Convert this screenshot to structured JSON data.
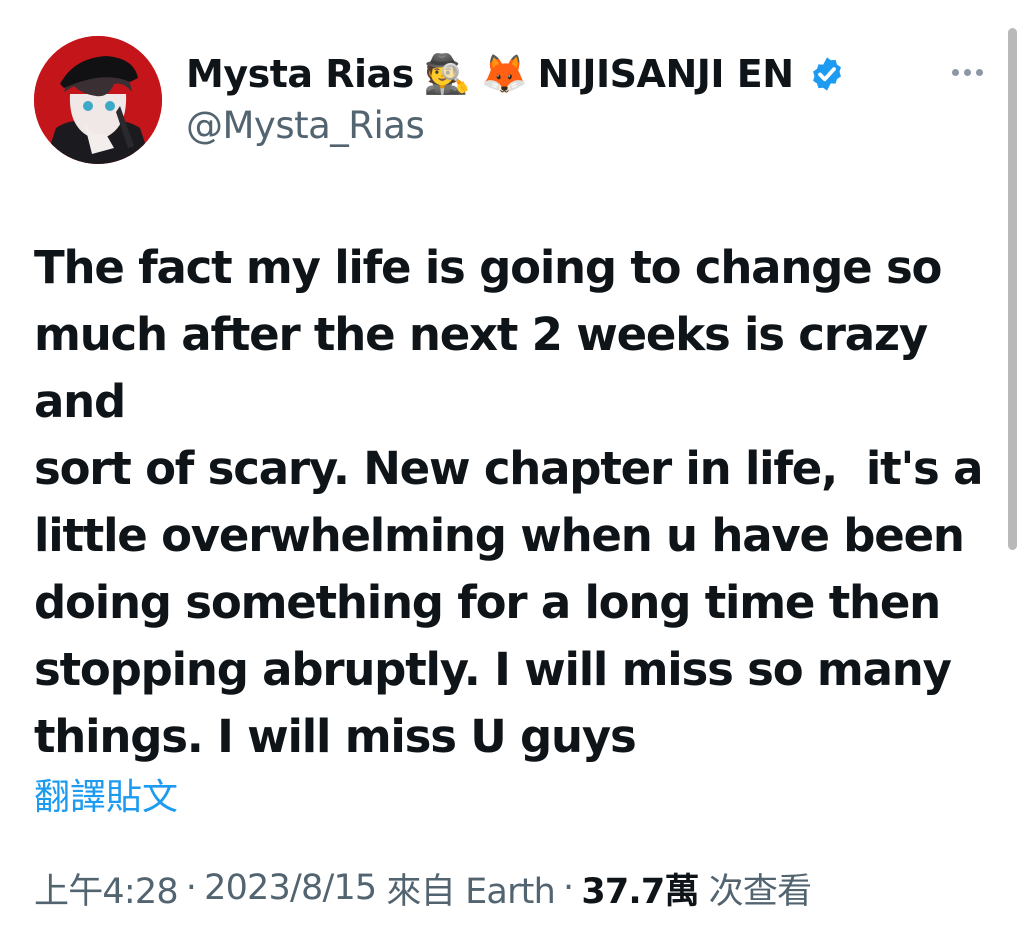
{
  "tweet": {
    "author": {
      "display_name": "Mysta Rias",
      "emoji_1": "🕵",
      "emoji_2": "🦊",
      "affiliation": "NIJISANJI EN",
      "handle": "@Mysta_Rias",
      "verified_icon": "verified-badge-icon",
      "avatar_icon": "avatar-image"
    },
    "body": "The fact my life is going to change so\nmuch after the next 2 weeks is crazy and\nsort of scary. New chapter in life,  it's a\nlittle overwhelming when u have been\ndoing something for a long time then\nstopping abruptly. I will miss so many\nthings. I will miss U guys",
    "translate_label": "翻譯貼文",
    "meta": {
      "time": "上午4:28",
      "date": "2023/8/15",
      "source": "來自 Earth",
      "views": "37.7萬",
      "views_label": "次查看",
      "separator": "·"
    }
  },
  "colors": {
    "text": "#0f1419",
    "secondary": "#536471",
    "link": "#1d9bf0",
    "verified": "#1d9bf0",
    "avatar_background": "#c4151b"
  }
}
